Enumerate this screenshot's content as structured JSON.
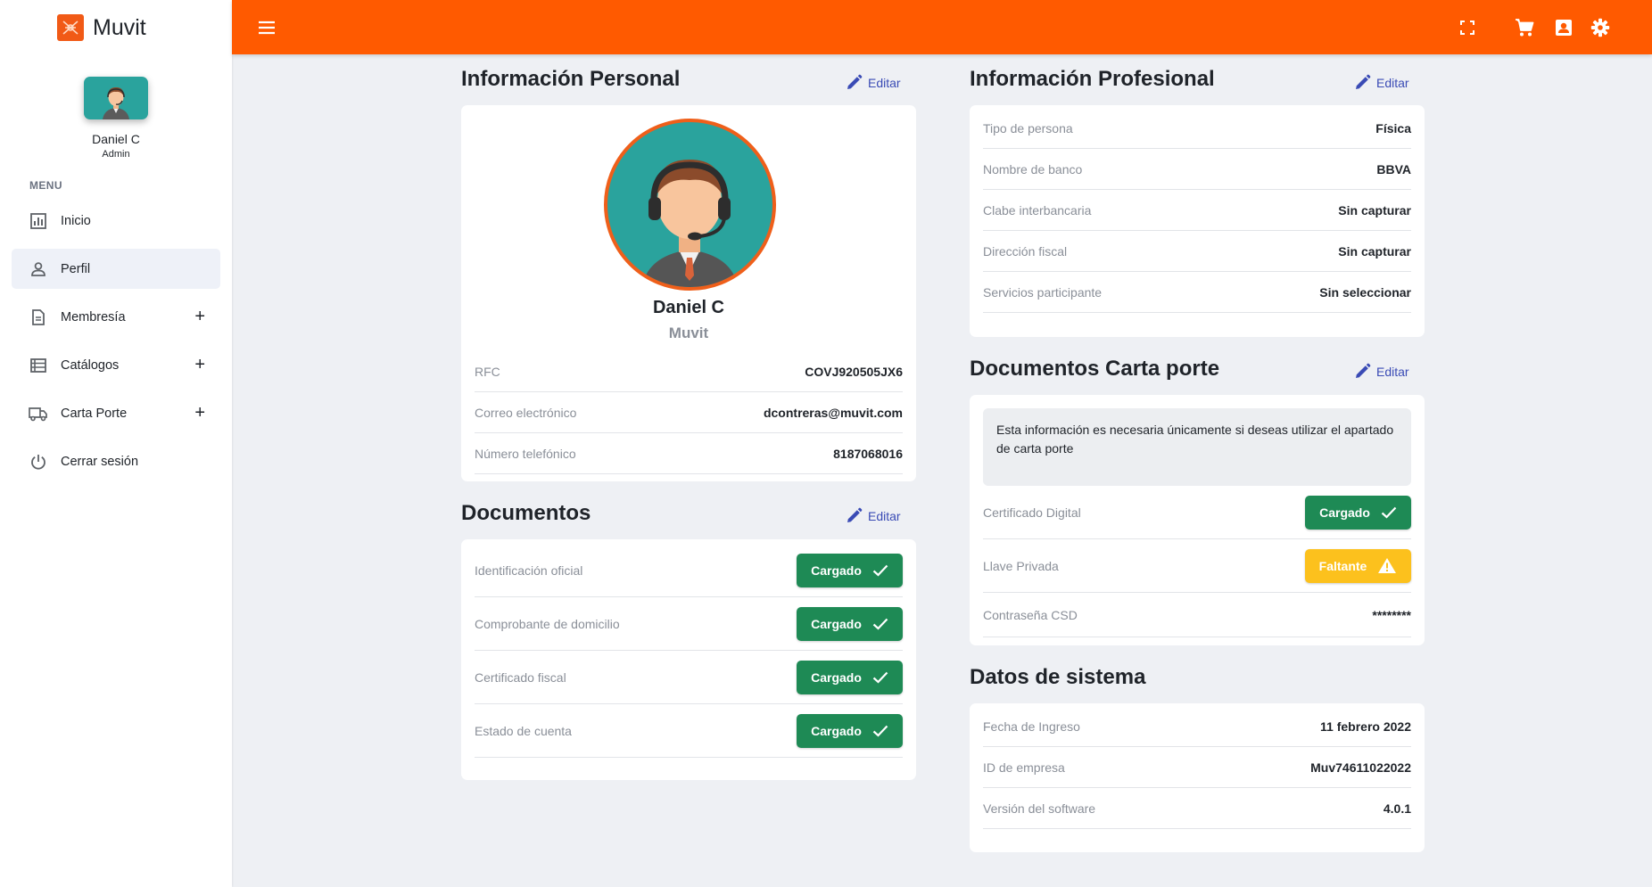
{
  "app": {
    "name": "Muvit"
  },
  "user": {
    "name": "Daniel C",
    "role": "Admin"
  },
  "sidebar": {
    "menu_title": "MENU",
    "items": [
      {
        "label": "Inicio",
        "icon": "chart-icon",
        "expandable": false
      },
      {
        "label": "Perfil",
        "icon": "person-icon",
        "expandable": false,
        "active": true
      },
      {
        "label": "Membresía",
        "icon": "document-icon",
        "expandable": true
      },
      {
        "label": "Catálogos",
        "icon": "list-icon",
        "expandable": true
      },
      {
        "label": "Carta Porte",
        "icon": "truck-icon",
        "expandable": true
      },
      {
        "label": "Cerrar sesión",
        "icon": "power-icon",
        "expandable": false
      }
    ],
    "expand_symbol": "+"
  },
  "topbar": {
    "icons": [
      "menu-icon",
      "fullscreen-icon",
      "cart-icon",
      "contact-icon",
      "gear-icon"
    ],
    "color": "#ff5a00"
  },
  "edit_label": "Editar",
  "personal": {
    "title": "Información Personal",
    "name": "Daniel C",
    "company": "Muvit",
    "rows": [
      {
        "label": "RFC",
        "value": "COVJ920505JX6"
      },
      {
        "label": "Correo electrónico",
        "value": "dcontreras@muvit.com"
      },
      {
        "label": "Número telefónico",
        "value": "8187068016"
      }
    ]
  },
  "documentos": {
    "title": "Documentos",
    "rows": [
      {
        "label": "Identificación oficial",
        "status": "Cargado"
      },
      {
        "label": "Comprobante de domicilio",
        "status": "Cargado"
      },
      {
        "label": "Certificado fiscal",
        "status": "Cargado"
      },
      {
        "label": "Estado de cuenta",
        "status": "Cargado"
      }
    ]
  },
  "profesional": {
    "title": "Información Profesional",
    "rows": [
      {
        "label": "Tipo de persona",
        "value": "Física"
      },
      {
        "label": "Nombre de banco",
        "value": "BBVA"
      },
      {
        "label": "Clabe interbancaria",
        "value": "Sin capturar"
      },
      {
        "label": "Dirección fiscal",
        "value": "Sin capturar"
      },
      {
        "label": "Servicios participante",
        "value": "Sin seleccionar"
      }
    ]
  },
  "carta_porte": {
    "title": "Documentos Carta porte",
    "notice": "Esta información es necesaria únicamente si deseas utilizar el apartado de carta porte",
    "rows": [
      {
        "label": "Certificado Digital",
        "status": "Cargado",
        "state": "ok"
      },
      {
        "label": "Llave Privada",
        "status": "Faltante",
        "state": "warn"
      },
      {
        "label": "Contraseña CSD",
        "value": "********"
      }
    ]
  },
  "sistema": {
    "title": "Datos de sistema",
    "rows": [
      {
        "label": "Fecha de Ingreso",
        "value": "11 febrero 2022"
      },
      {
        "label": "ID de empresa",
        "value": "Muv74611022022"
      },
      {
        "label": "Versión del software",
        "value": "4.0.1"
      }
    ]
  },
  "colors": {
    "success": "#1e8a55",
    "warning": "#fcc11d",
    "link": "#3a4bb5",
    "accent": "#ff5a00"
  }
}
